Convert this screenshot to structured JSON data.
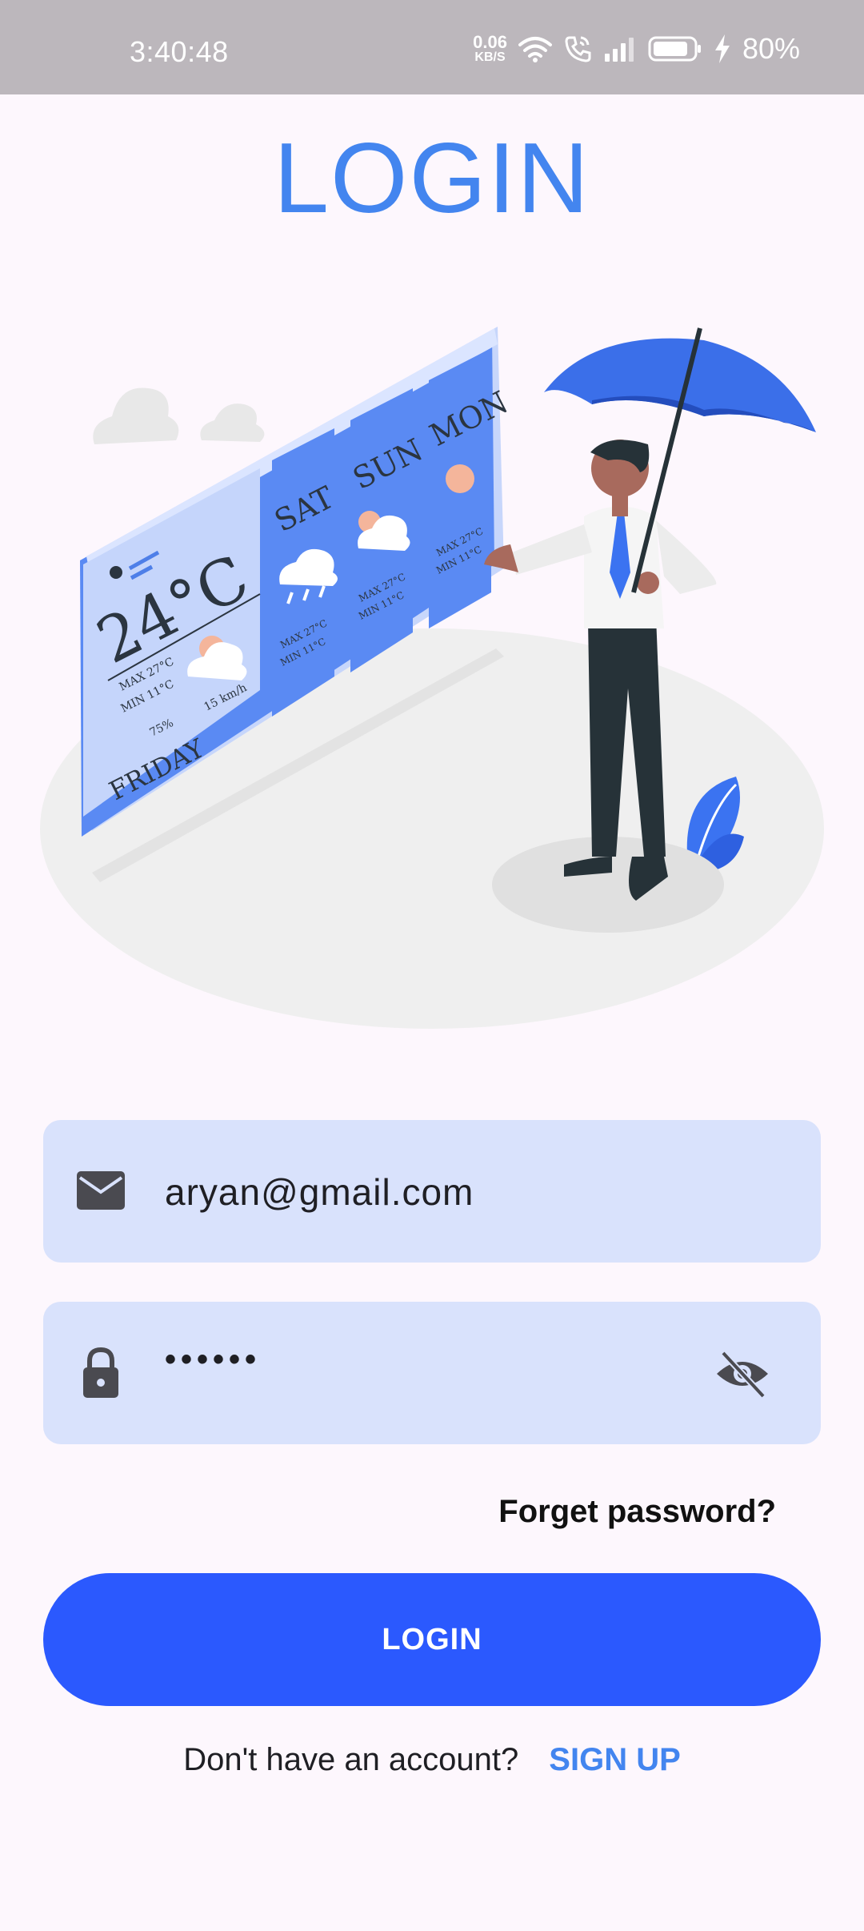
{
  "status_bar": {
    "time": "3:40:48",
    "net_speed_value": "0.06",
    "net_speed_unit": "KB/S",
    "battery_percent": "80%",
    "icons": [
      "wifi-icon",
      "call-icon",
      "signal-icon",
      "battery-icon",
      "charging-icon"
    ]
  },
  "page": {
    "title": "LOGIN"
  },
  "illustration": {
    "temperature": "24°C",
    "today_day": "FRIDAY",
    "today_max": "MAX  27°C",
    "today_min": "MIN   11°C",
    "humidity": "75%",
    "wind": "15 km/h",
    "forecast": [
      {
        "day": "SAT",
        "max": "MAX 27°C",
        "min": "MIN  11°C"
      },
      {
        "day": "SUN",
        "max": "MAX 27°C",
        "min": "MIN  11°C"
      },
      {
        "day": "MON",
        "max": "MAX 27°C",
        "min": "MIN  11°C"
      }
    ]
  },
  "form": {
    "email": {
      "value": "aryan@gmail.com",
      "icon": "mail-icon"
    },
    "password": {
      "value": "••••••",
      "icon": "lock-icon",
      "toggle_icon": "visibility-off-icon"
    },
    "forgot_password": "Forget password?",
    "login_button": "LOGIN",
    "signup_prompt": "Don't have an account?",
    "signup_link": "SIGN UP"
  },
  "colors": {
    "accent": "#4385ef",
    "button": "#2b59fe",
    "field_bg": "#d9e2fc",
    "background": "#fdf7fd"
  }
}
